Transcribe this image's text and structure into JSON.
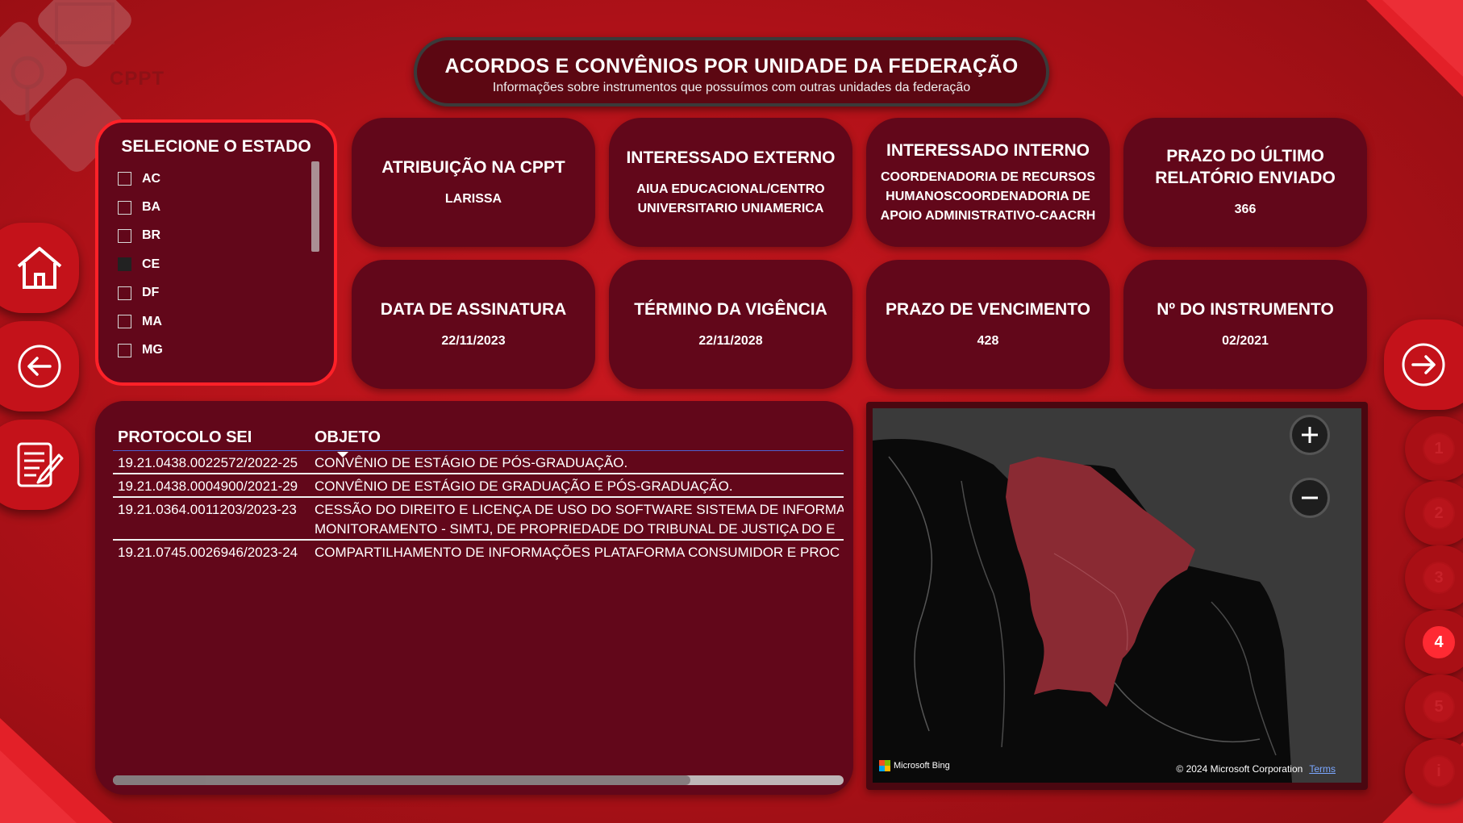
{
  "logo": {
    "text": "CPPT"
  },
  "header": {
    "title": "ACORDOS E CONVÊNIOS POR UNIDADE DA FEDERAÇÃO",
    "subtitle": "Informações sobre instrumentos que possuímos com outras unidades da federação"
  },
  "slicer": {
    "title": "SELECIONE O ESTADO",
    "items": [
      {
        "label": "AC",
        "checked": false
      },
      {
        "label": "BA",
        "checked": false
      },
      {
        "label": "BR",
        "checked": false
      },
      {
        "label": "CE",
        "checked": true
      },
      {
        "label": "DF",
        "checked": false
      },
      {
        "label": "MA",
        "checked": false
      },
      {
        "label": "MG",
        "checked": false
      }
    ]
  },
  "cards": {
    "atribuicao": {
      "label": "ATRIBUIÇÃO NA CPPT",
      "value": "LARISSA"
    },
    "interessado_externo": {
      "label": "INTERESSADO EXTERNO",
      "value": "AIUA EDUCACIONAL/CENTRO UNIVERSITARIO UNIAMERICA"
    },
    "interessado_interno": {
      "label": "INTERESSADO INTERNO",
      "value": "COORDENADORIA DE RECURSOS HUMANOSCOORDENADORIA DE APOIO ADMINISTRATIVO-CAACRH"
    },
    "prazo_relatorio": {
      "label": "PRAZO DO ÚLTIMO RELATÓRIO ENVIADO",
      "value": "366"
    },
    "data_assinatura": {
      "label": "DATA DE ASSINATURA",
      "value": "22/11/2023"
    },
    "termino_vigencia": {
      "label": "TÉRMINO DA VIGÊNCIA",
      "value": "22/11/2028"
    },
    "prazo_vencimento": {
      "label": "PRAZO DE VENCIMENTO",
      "value": "428"
    },
    "numero_instrumento": {
      "label": "Nº DO INSTRUMENTO",
      "value": "02/2021"
    }
  },
  "table": {
    "columns": [
      "PROTOCOLO SEI",
      "OBJETO"
    ],
    "rows": [
      {
        "protocolo": "19.21.0438.0022572/2022-25",
        "objeto": [
          "CONVÊNIO DE ESTÁGIO DE PÓS-GRADUAÇÃO."
        ]
      },
      {
        "protocolo": "19.21.0438.0004900/2021-29",
        "objeto": [
          "CONVÊNIO DE ESTÁGIO DE GRADUAÇÃO E PÓS-GRADUAÇÃO."
        ]
      },
      {
        "protocolo": "19.21.0364.0011203/2023-23",
        "objeto": [
          "CESSÃO DO DIREITO E LICENÇA DE USO DO SOFTWARE SISTEMA DE INFORMA",
          "MONITORAMENTO - SIMTJ, DE PROPRIEDADE DO TRIBUNAL DE JUSTIÇA DO E"
        ]
      },
      {
        "protocolo": "19.21.0745.0026946/2023-24",
        "objeto": [
          "COMPARTILHAMENTO DE INFORMAÇÕES PLATAFORMA CONSUMIDOR E PROC"
        ]
      }
    ]
  },
  "map": {
    "attribution": "Microsoft Bing",
    "copyright": "© 2024 Microsoft Corporation",
    "terms": "Terms",
    "highlight_color": "#8a2a33"
  },
  "pages": [
    "1",
    "2",
    "3",
    "4",
    "5",
    "i"
  ],
  "active_page": "4",
  "icons": {
    "home": "home-icon",
    "back": "arrow-left-icon",
    "doc": "document-edit-icon",
    "next": "arrow-right-icon",
    "zoom_in": "plus-icon",
    "zoom_out": "minus-icon"
  },
  "colors": {
    "accent": "#ff2128",
    "card_bg": "#62071a",
    "background": "#b41219"
  }
}
